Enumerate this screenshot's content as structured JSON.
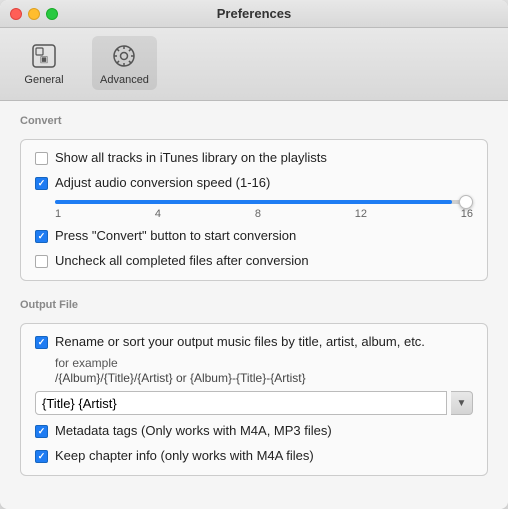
{
  "window": {
    "title": "Preferences"
  },
  "toolbar": {
    "items": [
      {
        "id": "general",
        "label": "General",
        "icon": "⊟",
        "active": false
      },
      {
        "id": "advanced",
        "label": "Advanced",
        "icon": "⚙",
        "active": true
      }
    ]
  },
  "convert_section": {
    "title": "Convert",
    "options": [
      {
        "id": "show-all-tracks",
        "label": "Show all tracks in iTunes library on the playlists",
        "checked": false
      },
      {
        "id": "adjust-speed",
        "label": "Adjust audio conversion speed (1-16)",
        "checked": true
      },
      {
        "id": "press-convert",
        "label": "Press \"Convert\" button to start conversion",
        "checked": true
      },
      {
        "id": "uncheck-completed",
        "label": "Uncheck all completed files after conversion",
        "checked": false
      }
    ],
    "slider": {
      "min": 1,
      "max": 16,
      "value": 16,
      "labels": [
        "1",
        "4",
        "8",
        "12",
        "16"
      ]
    }
  },
  "output_section": {
    "title": "Output File",
    "rename_option": {
      "id": "rename-sort",
      "label": "Rename or sort your output music files by title, artist, album, etc.",
      "checked": true
    },
    "example_label": "for example",
    "example_code": "/{Album}/{Title}/{Artist} or {Album}-{Title}-{Artist}",
    "input_value": "{Title} {Artist}",
    "metadata_option": {
      "id": "metadata-tags",
      "label": "Metadata tags (Only works with M4A, MP3 files)",
      "checked": true
    },
    "chapter_option": {
      "id": "keep-chapter",
      "label": "Keep chapter info (only works with  M4A files)",
      "checked": true
    }
  },
  "colors": {
    "accent": "#1e7cf3",
    "checked_bg": "#1e7cf3"
  }
}
